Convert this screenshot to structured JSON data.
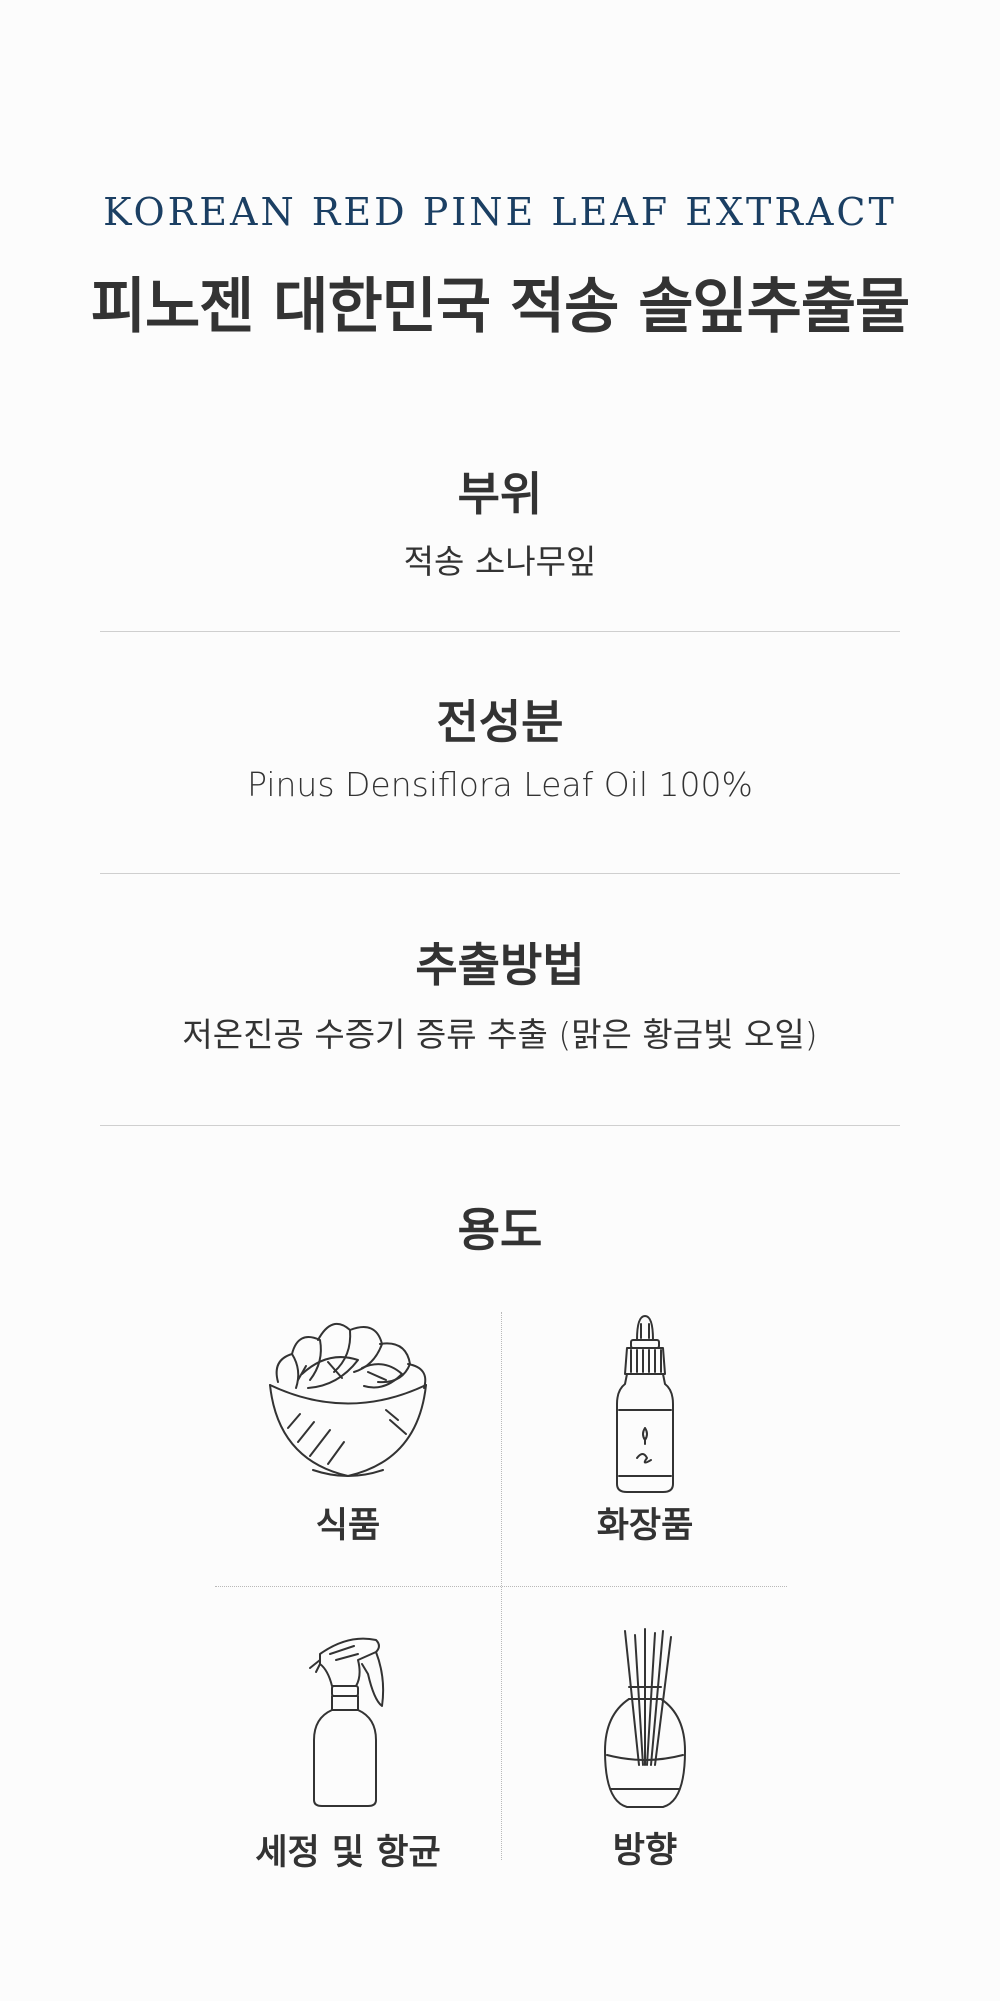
{
  "header": {
    "eyebrow": "KOREAN RED PINE LEAF EXTRACT",
    "title": "피노젠 대한민국 적송 솔잎추출물"
  },
  "sections": [
    {
      "heading": "부위",
      "value": "적송 소나무잎"
    },
    {
      "heading": "전성분",
      "value": "Pinus Densiflora Leaf Oil 100%"
    },
    {
      "heading": "추출방법",
      "value": "저온진공 수증기 증류 추출 (맑은 황금빛 오일)"
    }
  ],
  "uses": {
    "heading": "용도",
    "items": [
      {
        "label": "식품",
        "icon": "salad-bowl-icon"
      },
      {
        "label": "화장품",
        "icon": "dropper-bottle-icon"
      },
      {
        "label": "세정 및 항균",
        "icon": "spray-bottle-icon"
      },
      {
        "label": "방향",
        "icon": "reed-diffuser-icon"
      }
    ]
  }
}
